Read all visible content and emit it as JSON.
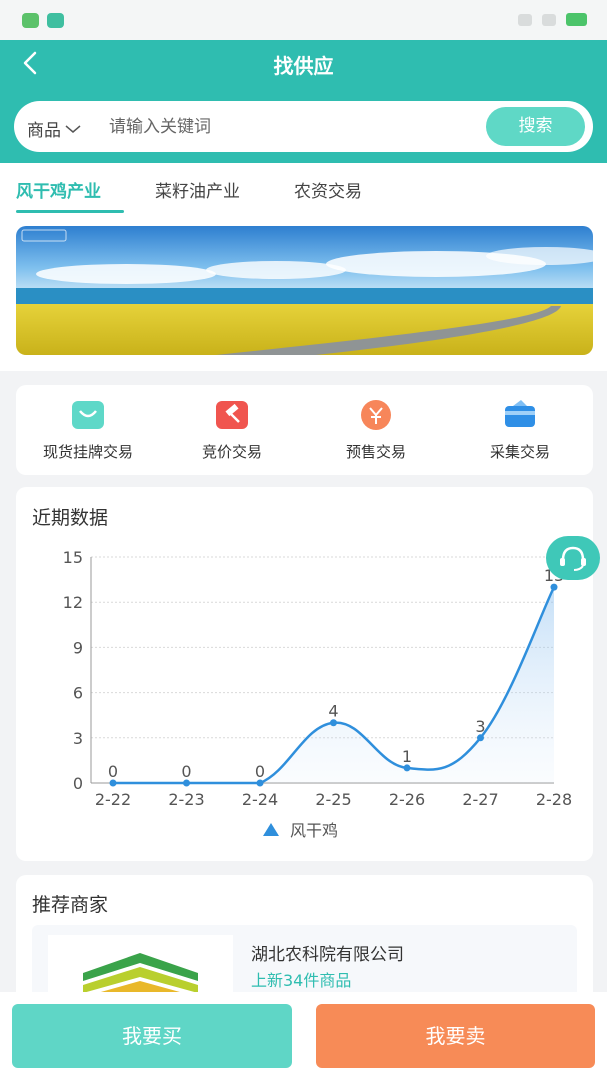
{
  "header": {
    "title": "找供应"
  },
  "search": {
    "category": "商品",
    "placeholder": "请输入关键词",
    "button": "搜索"
  },
  "tabs": [
    {
      "label": "风干鸡产业",
      "active": true
    },
    {
      "label": "菜籽油产业",
      "active": false
    },
    {
      "label": "农资交易",
      "active": false
    }
  ],
  "services": [
    {
      "label": "现货挂牌交易",
      "icon": "basket-icon"
    },
    {
      "label": "竞价交易",
      "icon": "gavel-icon"
    },
    {
      "label": "预售交易",
      "icon": "yen-icon"
    },
    {
      "label": "采集交易",
      "icon": "card-icon"
    }
  ],
  "chart_section": {
    "title": "近期数据"
  },
  "chart_data": {
    "type": "line",
    "categories": [
      "2-22",
      "2-23",
      "2-24",
      "2-25",
      "2-26",
      "2-27",
      "2-28"
    ],
    "series": [
      {
        "name": "风干鸡",
        "values": [
          0,
          0,
          0,
          4,
          1,
          3,
          13
        ],
        "color": "#2f8fdc"
      }
    ],
    "yticks": [
      "0",
      "3",
      "6",
      "9",
      "12",
      "15"
    ],
    "ylim": [
      0,
      15
    ],
    "grid": true,
    "smooth": true,
    "area_fill": true,
    "legend_position": "bottom"
  },
  "merchants": {
    "title": "推荐商家",
    "items": [
      {
        "name": "湖北农科院有限公司",
        "subtitle": "上新34件商品"
      }
    ]
  },
  "bottom": {
    "buy": "我要买",
    "sell": "我要卖"
  }
}
